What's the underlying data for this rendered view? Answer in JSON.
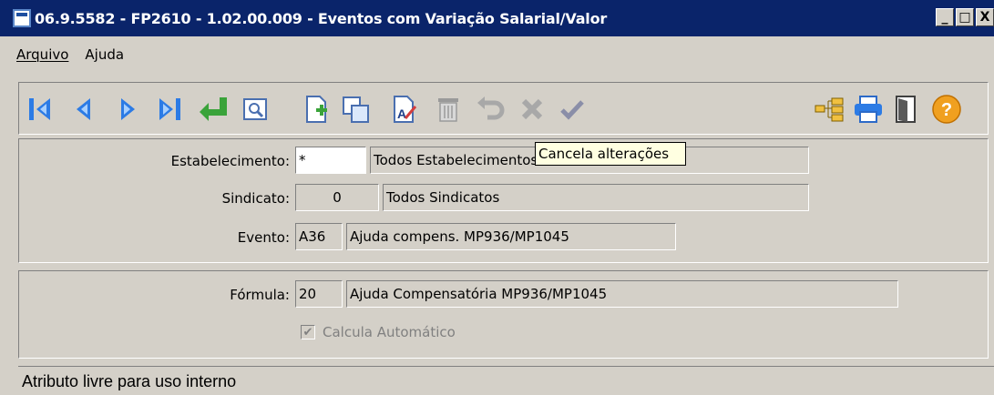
{
  "window": {
    "title": "06.9.5582 - FP2610 - 1.02.00.009 - Eventos com Variação Salarial/Valor",
    "buttons": [
      "_",
      "□",
      "X"
    ]
  },
  "menu": {
    "items": [
      "Arquivo",
      "Ajuda"
    ]
  },
  "toolbar": {
    "icons": [
      "first-record-icon",
      "previous-record-icon",
      "next-record-icon",
      "last-record-icon",
      "goto-icon",
      "search-icon",
      "new-record-icon",
      "copy-record-icon",
      "edit-record-icon",
      "delete-record-icon",
      "undo-icon",
      "cancel-icon",
      "confirm-icon",
      "tree-icon",
      "print-icon",
      "exit-icon",
      "help-icon"
    ]
  },
  "tooltip": "Cancela alterações",
  "form": {
    "estabelecimento": {
      "label": "Estabelecimento:",
      "code": "*",
      "desc": "Todos Estabelecimentos"
    },
    "sindicato": {
      "label": "Sindicato:",
      "code": "0",
      "desc": "Todos Sindicatos"
    },
    "evento": {
      "label": "Evento:",
      "code": "A36",
      "desc": "Ajuda compens. MP936/MP1045"
    },
    "formula": {
      "label": "Fórmula:",
      "code": "20",
      "desc": "Ajuda Compensatória MP936/MP1045"
    },
    "calcula": {
      "label": "Calcula Automático",
      "checked": true
    }
  },
  "status": "Atributo livre para uso interno"
}
